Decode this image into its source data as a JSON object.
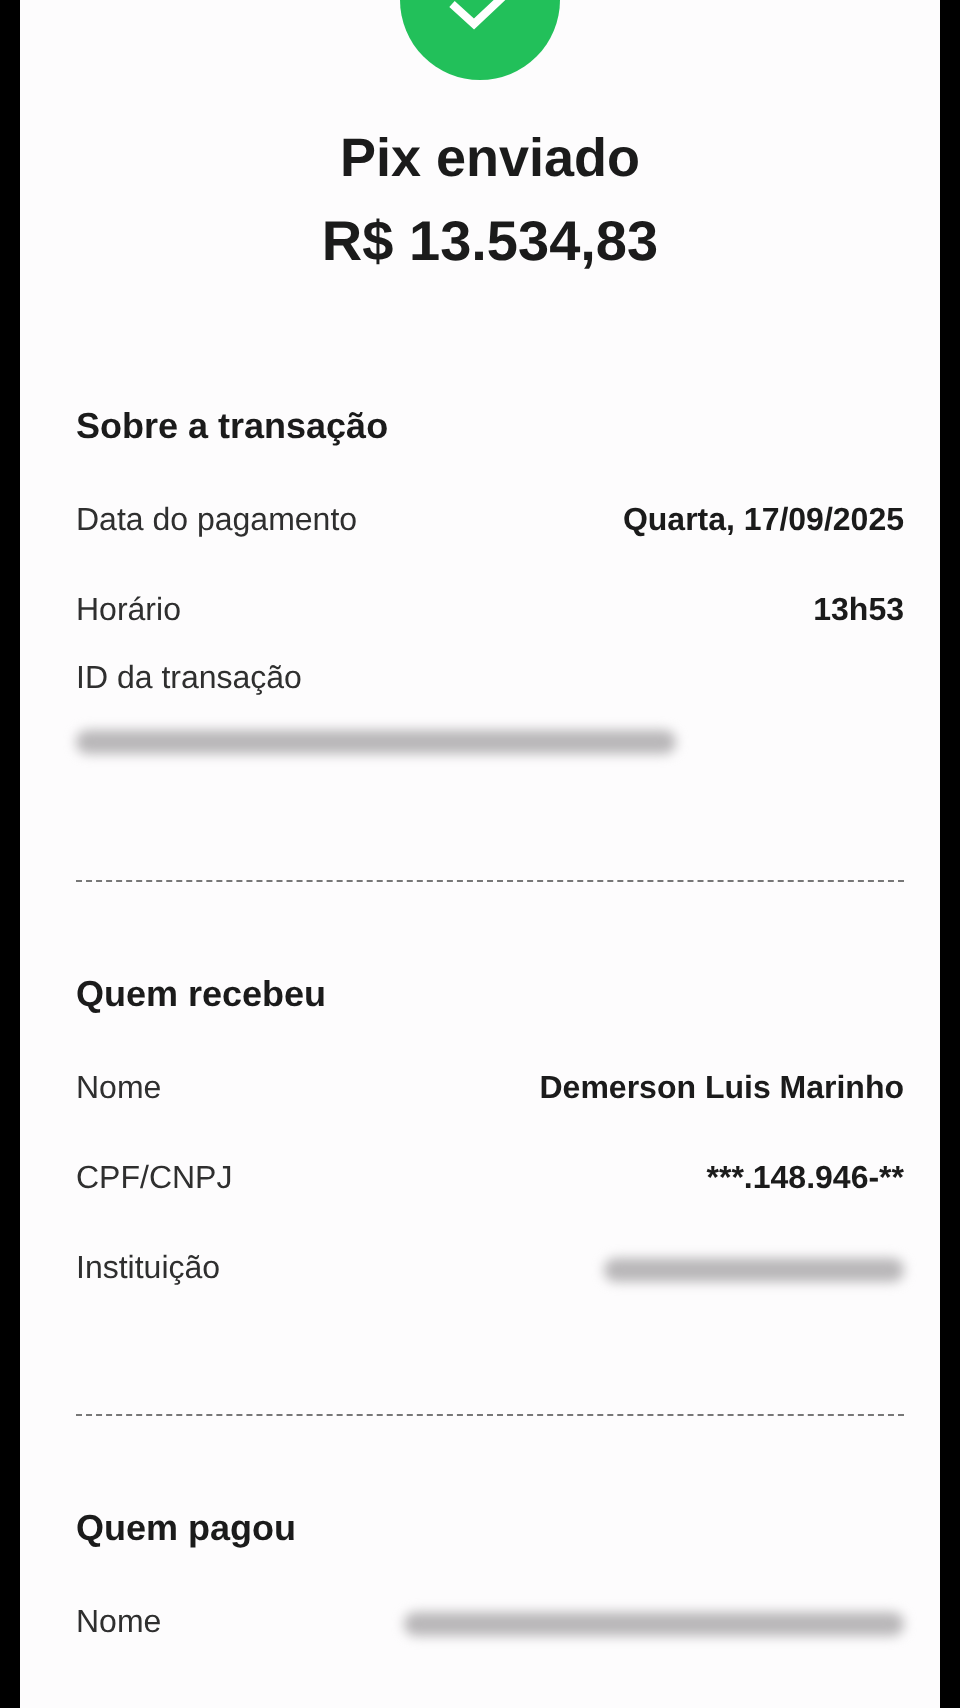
{
  "header": {
    "title": "Pix enviado",
    "amount": "R$ 13.534,83"
  },
  "sections": [
    {
      "title": "Sobre a transação",
      "rows": [
        {
          "kind": "inline",
          "label": "Data do pagamento",
          "value": "Quarta, 17/09/2025",
          "redacted": false
        },
        {
          "kind": "inline",
          "label": "Horário",
          "value": "13h53",
          "redacted": false
        },
        {
          "kind": "stacked",
          "label": "ID da transação",
          "redacted": true
        }
      ]
    },
    {
      "title": "Quem recebeu",
      "rows": [
        {
          "kind": "inline",
          "label": "Nome",
          "value": "Demerson Luis Marinho",
          "redacted": false
        },
        {
          "kind": "inline",
          "label": "CPF/CNPJ",
          "value": "***.148.946-**",
          "redacted": false
        },
        {
          "kind": "inline",
          "label": "Instituição",
          "redacted": true
        }
      ]
    },
    {
      "title": "Quem pagou",
      "rows": [
        {
          "kind": "inline",
          "label": "Nome",
          "redacted": true
        }
      ]
    }
  ]
}
